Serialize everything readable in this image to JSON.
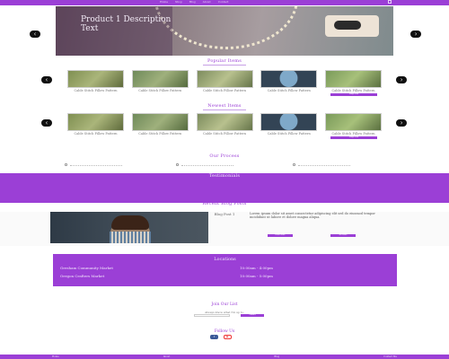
{
  "header": {
    "logo": "",
    "menu": [
      "Home",
      "Shop",
      "Blog",
      "About",
      "Contact"
    ]
  },
  "hero": {
    "caption": "Product 1 Description Text",
    "prev_icon": "chevron-left-icon",
    "next_icon": "chevron-right-icon"
  },
  "popular": {
    "title": "Popular Items",
    "items": [
      {
        "label": "Cable Stitch Pillow Pattern"
      },
      {
        "label": "Cable Stitch Pillow Pattern"
      },
      {
        "label": "Cable Stitch Pillow Pattern"
      },
      {
        "label": "Cable Stitch Pillow Pattern"
      },
      {
        "label": "Cable Stitch Pillow Pattern"
      }
    ],
    "button": "Shop Now"
  },
  "newest": {
    "title": "Newest Items",
    "items": [
      {
        "label": "Cable Stitch Pillow Pattern"
      },
      {
        "label": "Cable Stitch Pillow Pattern"
      },
      {
        "label": "Cable Stitch Pillow Pattern"
      },
      {
        "label": "Cable Stitch Pillow Pattern"
      },
      {
        "label": "Cable Stitch Pillow Pattern"
      }
    ],
    "button": "Shop Now"
  },
  "process": {
    "title": "Our Process"
  },
  "testimonials": {
    "title": "Testimonials"
  },
  "blog": {
    "title": "Recent Blog Posts",
    "post_title": "Blog Post 1",
    "excerpt": "Lorem ipsum dolor sit amet consectetur adipiscing elit sed do eiusmod tempor incididunt ut labore et dolore magna aliqua.",
    "read_more": "Read More",
    "all_posts": "All Posts"
  },
  "locations": {
    "title": "Locations",
    "rows": [
      {
        "name": "Gresham Community Market",
        "hours": "10:00am - 4:00pm"
      },
      {
        "name": "Oregon Crafters Market",
        "hours": "10:00am - 5:00pm"
      }
    ]
  },
  "join": {
    "title": "Join Our List",
    "desc": "Always know what I'm up to.",
    "submit": "Submit"
  },
  "follow": {
    "title": "Follow Us"
  },
  "footer": {
    "links": [
      "Home",
      "About",
      "Blog",
      "Contact Me"
    ]
  },
  "colors": {
    "accent": "#9b3fd6",
    "text": "#222222"
  }
}
